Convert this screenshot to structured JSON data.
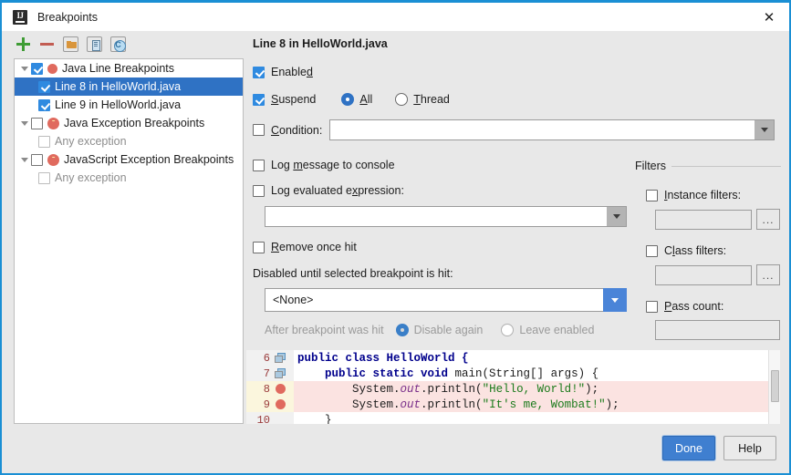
{
  "window": {
    "title": "Breakpoints",
    "app_icon": "intellij-idea-icon",
    "close_icon": "✕",
    "accent_color": "#1a8fd4"
  },
  "toolbar": {
    "icons": [
      {
        "name": "add-breakpoint-icon",
        "glyph": "+"
      },
      {
        "name": "remove-breakpoint-icon",
        "glyph": "−"
      },
      {
        "name": "group-by-folder-icon",
        "glyph": "folder"
      },
      {
        "name": "group-by-file-icon",
        "glyph": "file"
      },
      {
        "name": "group-by-class-icon",
        "glyph": "class"
      }
    ]
  },
  "tree": {
    "items": [
      {
        "label": "Java Line Breakpoints",
        "depth": 0,
        "checked": true,
        "expanded": true,
        "icon": "breakpoint-dot-icon",
        "selected": false,
        "dim": false
      },
      {
        "label": "Line 8 in HelloWorld.java",
        "depth": 1,
        "checked": true,
        "expanded": false,
        "icon": "none",
        "selected": true,
        "dim": false
      },
      {
        "label": "Line 9 in HelloWorld.java",
        "depth": 1,
        "checked": true,
        "expanded": false,
        "icon": "none",
        "selected": false,
        "dim": false
      },
      {
        "label": "Java Exception Breakpoints",
        "depth": 0,
        "checked": false,
        "expanded": true,
        "icon": "exception-breakpoint-icon",
        "selected": false,
        "dim": false
      },
      {
        "label": "Any exception",
        "depth": 1,
        "checked": false,
        "expanded": false,
        "icon": "none",
        "selected": false,
        "dim": true
      },
      {
        "label": "JavaScript Exception Breakpoints",
        "depth": 0,
        "checked": false,
        "expanded": true,
        "icon": "exception-breakpoint-icon",
        "selected": false,
        "dim": false
      },
      {
        "label": "Any exception",
        "depth": 1,
        "checked": false,
        "expanded": false,
        "icon": "none",
        "selected": false,
        "dim": true
      }
    ]
  },
  "details": {
    "title": "Line 8 in HelloWorld.java",
    "enabled": {
      "label_pre": "Enable",
      "label_mn": "d",
      "label_post": "",
      "checked": true
    },
    "suspend": {
      "label_pre": "",
      "label_mn": "S",
      "label_post": "uspend",
      "checked": true
    },
    "suspend_all": {
      "label_pre": "",
      "label_mn": "A",
      "label_post": "ll",
      "selected": true
    },
    "suspend_thread": {
      "label_pre": "",
      "label_mn": "T",
      "label_post": "hread",
      "selected": false
    },
    "condition": {
      "label_pre": "",
      "label_mn": "C",
      "label_post": "ondition:",
      "checked": false,
      "value": ""
    },
    "log_message": {
      "label_pre": "Log ",
      "label_mn": "m",
      "label_post": "essage to console",
      "checked": false
    },
    "log_expression": {
      "label_pre": "Log evaluated e",
      "label_mn": "x",
      "label_post": "pression:",
      "checked": false,
      "value": ""
    },
    "remove_once_hit": {
      "label_pre": "",
      "label_mn": "R",
      "label_post": "emove once hit",
      "checked": false
    },
    "disabled_until_label": "Disabled until selected breakpoint is hit:",
    "disabled_until_value": "<None>",
    "after_hit_label": "After breakpoint was hit",
    "after_hit_disable_again": {
      "label": "Disable again",
      "selected": true
    },
    "after_hit_leave_enabled": {
      "label": "Leave enabled",
      "selected": false
    }
  },
  "filters": {
    "legend": "Filters",
    "instance": {
      "label_pre": "",
      "label_mn": "I",
      "label_post": "nstance filters:",
      "checked": false,
      "value": "",
      "browse_label": "..."
    },
    "class": {
      "label_pre": "C",
      "label_mn": "l",
      "label_post": "ass filters:",
      "checked": false,
      "value": "",
      "browse_label": "..."
    },
    "pass_count": {
      "label_pre": "",
      "label_mn": "P",
      "label_post": "ass count:",
      "checked": false,
      "value": ""
    }
  },
  "code_preview": {
    "lines": [
      {
        "number": "6",
        "gutter_icon": "implementing-method-icon",
        "breakpoint": false,
        "highlight": false,
        "tokens": [
          {
            "t": "public class ",
            "c": "kw"
          },
          {
            "t": "HelloWorld {",
            "c": "kw"
          }
        ]
      },
      {
        "number": "7",
        "gutter_icon": "implementing-method-icon",
        "breakpoint": false,
        "highlight": false,
        "tokens": [
          {
            "t": "    ",
            "c": "pl"
          },
          {
            "t": "public static void ",
            "c": "kw"
          },
          {
            "t": "main(String[] args) {",
            "c": "pl"
          }
        ]
      },
      {
        "number": "8",
        "gutter_icon": "none",
        "breakpoint": true,
        "highlight": true,
        "tokens": [
          {
            "t": "        System.",
            "c": "pl"
          },
          {
            "t": "out",
            "c": "fld"
          },
          {
            "t": ".println(",
            "c": "pl"
          },
          {
            "t": "\"Hello, World!\"",
            "c": "str"
          },
          {
            "t": ");",
            "c": "pl"
          }
        ]
      },
      {
        "number": "9",
        "gutter_icon": "none",
        "breakpoint": true,
        "highlight": true,
        "tokens": [
          {
            "t": "        System.",
            "c": "pl"
          },
          {
            "t": "out",
            "c": "fld"
          },
          {
            "t": ".println(",
            "c": "pl"
          },
          {
            "t": "\"It's me, Wombat!\"",
            "c": "str"
          },
          {
            "t": ");",
            "c": "pl"
          }
        ]
      },
      {
        "number": "10",
        "gutter_icon": "none",
        "breakpoint": false,
        "highlight": false,
        "tokens": [
          {
            "t": "    }",
            "c": "pl"
          }
        ]
      }
    ]
  },
  "footer": {
    "done_label": "Done",
    "help_label": "Help"
  }
}
